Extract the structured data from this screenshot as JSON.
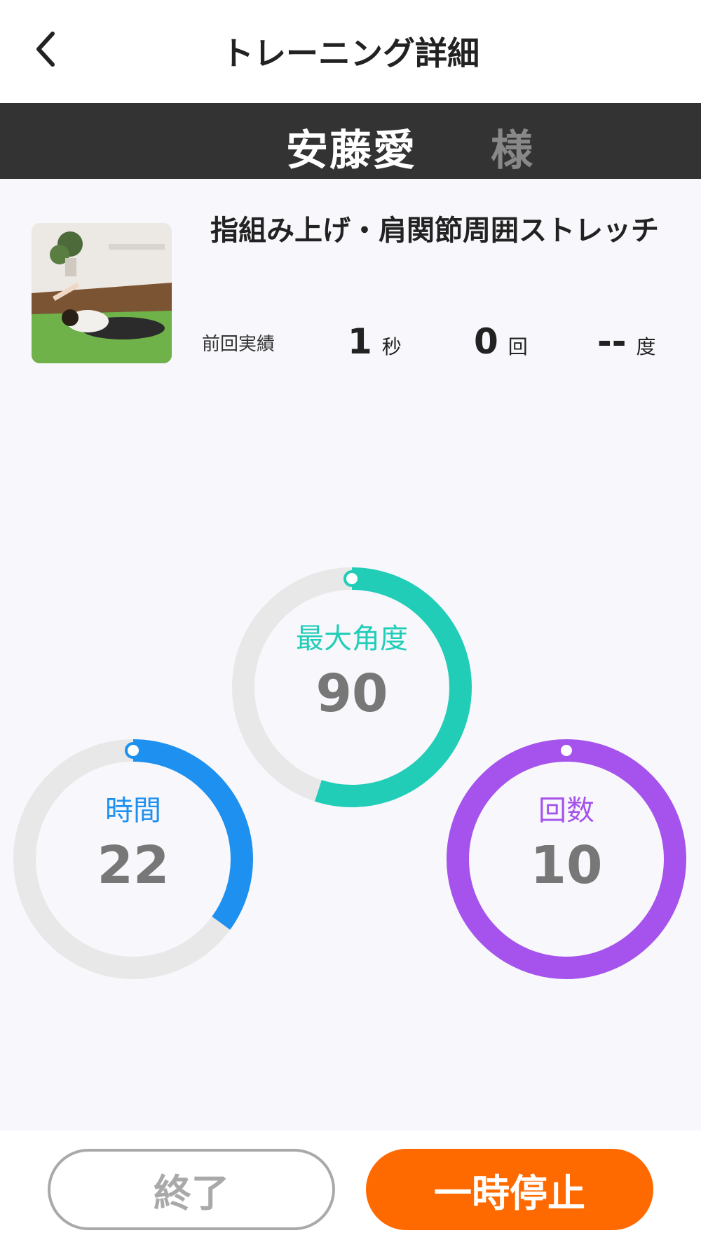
{
  "header": {
    "title": "トレーニング詳細"
  },
  "patient": {
    "name": "安藤愛",
    "suffix": "様"
  },
  "exercise": {
    "title": "指組み上げ・肩関節周囲ストレッチ",
    "previous_label": "前回実績",
    "stats": [
      {
        "value": "1",
        "unit": "秒"
      },
      {
        "value": "0",
        "unit": "回"
      },
      {
        "value": "--",
        "unit": "度"
      }
    ]
  },
  "gauges": {
    "angle": {
      "label": "最大角度",
      "value": "90",
      "color": "#22cdb8",
      "progress": 0.55
    },
    "time": {
      "label": "時間",
      "value": "22",
      "color": "#1e90f0",
      "progress": 0.35
    },
    "count": {
      "label": "回数",
      "value": "10",
      "color": "#a553ec",
      "progress": 1.0
    }
  },
  "buttons": {
    "end_label": "終了",
    "pause_label": "一時停止"
  },
  "icons": {
    "back": "chevron-left-icon"
  }
}
